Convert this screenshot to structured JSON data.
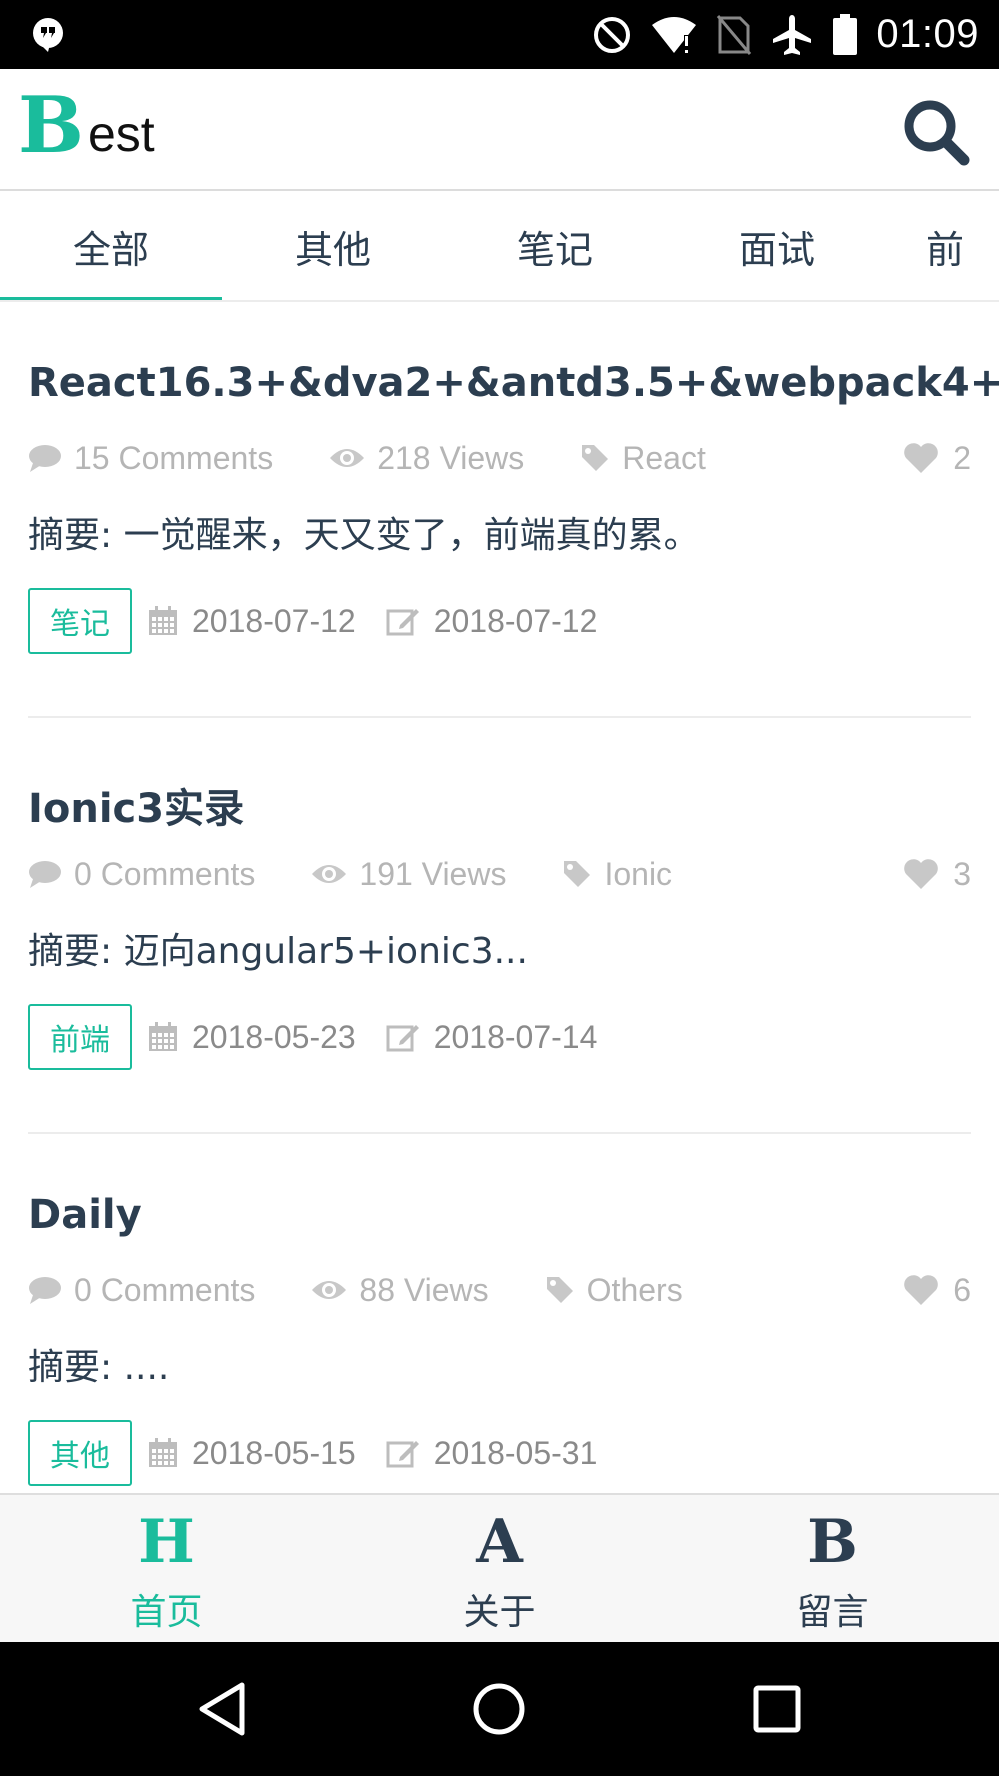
{
  "status_bar": {
    "time": "01:09"
  },
  "header": {
    "logo_letter": "B",
    "logo_rest": "est"
  },
  "tabs": [
    {
      "label": "全部"
    },
    {
      "label": "其他"
    },
    {
      "label": "笔记"
    },
    {
      "label": "面试"
    },
    {
      "label": "前"
    }
  ],
  "articles": [
    {
      "title": "React16.3+&dva2+&antd3.5+&webpack4+",
      "comments": "15 Comments",
      "views": "218 Views",
      "tag": "React",
      "likes": "2",
      "summary": "摘要: 一觉醒来，天又变了，前端真的累。",
      "category": "笔记",
      "created": "2018-07-12",
      "updated": "2018-07-12"
    },
    {
      "title": "Ionic3实录",
      "comments": "0 Comments",
      "views": "191 Views",
      "tag": "Ionic",
      "likes": "3",
      "summary": "摘要: 迈向angular5+ionic3...",
      "category": "前端",
      "created": "2018-05-23",
      "updated": "2018-07-14"
    },
    {
      "title": "Daily",
      "comments": "0 Comments",
      "views": "88 Views",
      "tag": "Others",
      "likes": "6",
      "summary": "摘要: ....",
      "category": "其他",
      "created": "2018-05-15",
      "updated": "2018-05-31"
    }
  ],
  "bottom_nav": [
    {
      "letter": "H",
      "label": "首页"
    },
    {
      "letter": "A",
      "label": "关于"
    },
    {
      "letter": "B",
      "label": "留言"
    }
  ],
  "colors": {
    "accent": "#1abc9c",
    "text": "#2c3e50",
    "muted": "#b5b5b5"
  },
  "icons": [
    "chat-bubble-icon",
    "eye-icon",
    "tag-icon",
    "heart-icon",
    "calendar-icon",
    "edit-icon",
    "search-icon"
  ]
}
